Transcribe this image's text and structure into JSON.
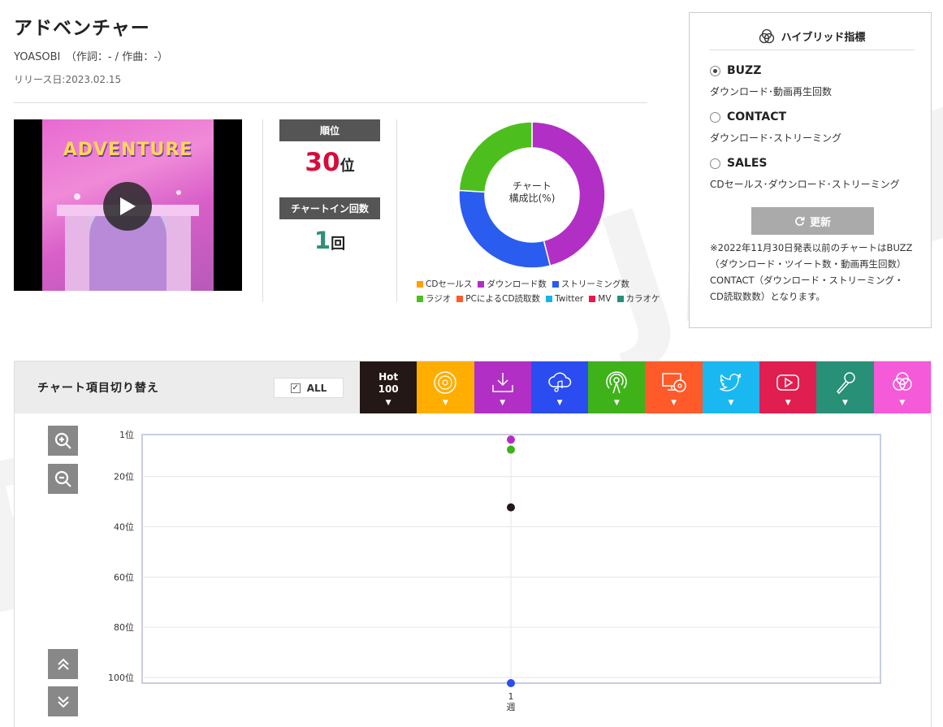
{
  "song": {
    "title": "アドベンチャー",
    "artist_line": "YOASOBI　（作詞：- / 作曲：-）",
    "release": "リリース日:2023.02.15"
  },
  "video": {
    "thumbnail_text": "ADVENTURE",
    "play_icon": "play-icon"
  },
  "rank": {
    "label": "順位",
    "value": "30",
    "unit": "位",
    "chart_in_label": "チャートイン回数",
    "chart_in_value": "1",
    "chart_in_unit": "回"
  },
  "composition": {
    "center_label_1": "チャート",
    "center_label_2": "構成比(%)",
    "segments": [
      {
        "name": "ダウンロード数",
        "percent": 46,
        "color": "#b22fc6"
      },
      {
        "name": "ストリーミング数",
        "percent": 30,
        "color": "#2a5cf0"
      },
      {
        "name": "ラジオ",
        "percent": 24,
        "color": "#4cbf1e"
      }
    ],
    "legend_row1": [
      {
        "label": "CDセールス",
        "color": "#ff9e00"
      },
      {
        "label": "ダウンロード数",
        "color": "#b22fc6"
      },
      {
        "label": "ストリーミング数",
        "color": "#2a5cf0"
      }
    ],
    "legend_row2": [
      {
        "label": "ラジオ",
        "color": "#4cbf1e"
      },
      {
        "label": "PCによるCD読取数",
        "color": "#ff5a2a"
      },
      {
        "label": "Twitter",
        "color": "#1ab2ee"
      },
      {
        "label": "MV",
        "color": "#e8194a"
      },
      {
        "label": "カラオケ",
        "color": "#279077"
      }
    ]
  },
  "hybrid": {
    "title": "ハイブリッド指標",
    "icon": "venn-icon",
    "options": [
      {
        "label": "BUZZ",
        "desc": "ダウンロード･動画再生回数",
        "checked": true
      },
      {
        "label": "CONTACT",
        "desc": "ダウンロード･ストリーミング",
        "checked": false
      },
      {
        "label": "SALES",
        "desc": "CDセールス･ダウンロード･ストリーミング",
        "checked": false
      }
    ],
    "update_label": "更新",
    "note": "※2022年11月30日発表以前のチャートはBUZZ（ダウンロード・ツイート数・動画再生回数）CONTACT（ダウンロード・ストリーミング・CD読取数数）となります。"
  },
  "toggle": {
    "title": "チャート項目切り替え",
    "all_label": "ALL",
    "hot_label_1": "Hot",
    "hot_label_2": "100",
    "tabs": [
      {
        "name": "hot100",
        "color": "#231815"
      },
      {
        "name": "cd-sales-icon",
        "color": "#ffae00"
      },
      {
        "name": "download-icon",
        "color": "#b22fc6"
      },
      {
        "name": "streaming-icon",
        "color": "#2a4cf0"
      },
      {
        "name": "radio-icon",
        "color": "#3fb21a"
      },
      {
        "name": "pc-cd-read-icon",
        "color": "#ff5a2a"
      },
      {
        "name": "twitter-icon",
        "color": "#1ab8f0"
      },
      {
        "name": "mv-icon",
        "color": "#e01e4f"
      },
      {
        "name": "karaoke-icon",
        "color": "#279077"
      },
      {
        "name": "hybrid-icon",
        "color": "#f55ad8"
      }
    ]
  },
  "chart_data": {
    "type": "scatter",
    "x_categories": [
      "1\n週"
    ],
    "y_ticks": [
      "1位",
      "20位",
      "40位",
      "60位",
      "80位",
      "100位"
    ],
    "y_tick_values": [
      1,
      20,
      40,
      60,
      80,
      100
    ],
    "ylim": [
      1,
      100
    ],
    "y_inverted": true,
    "grid": true,
    "series": [
      {
        "color": "#b22fc6",
        "points": [
          {
            "x": "1週",
            "y": 3
          }
        ]
      },
      {
        "color": "#3fb21a",
        "points": [
          {
            "x": "1週",
            "y": 7
          }
        ]
      },
      {
        "color": "#231815",
        "points": [
          {
            "x": "1週",
            "y": 30
          }
        ]
      },
      {
        "color": "#2a4cf0",
        "points": [
          {
            "x": "1週",
            "y": 100
          }
        ]
      }
    ]
  }
}
